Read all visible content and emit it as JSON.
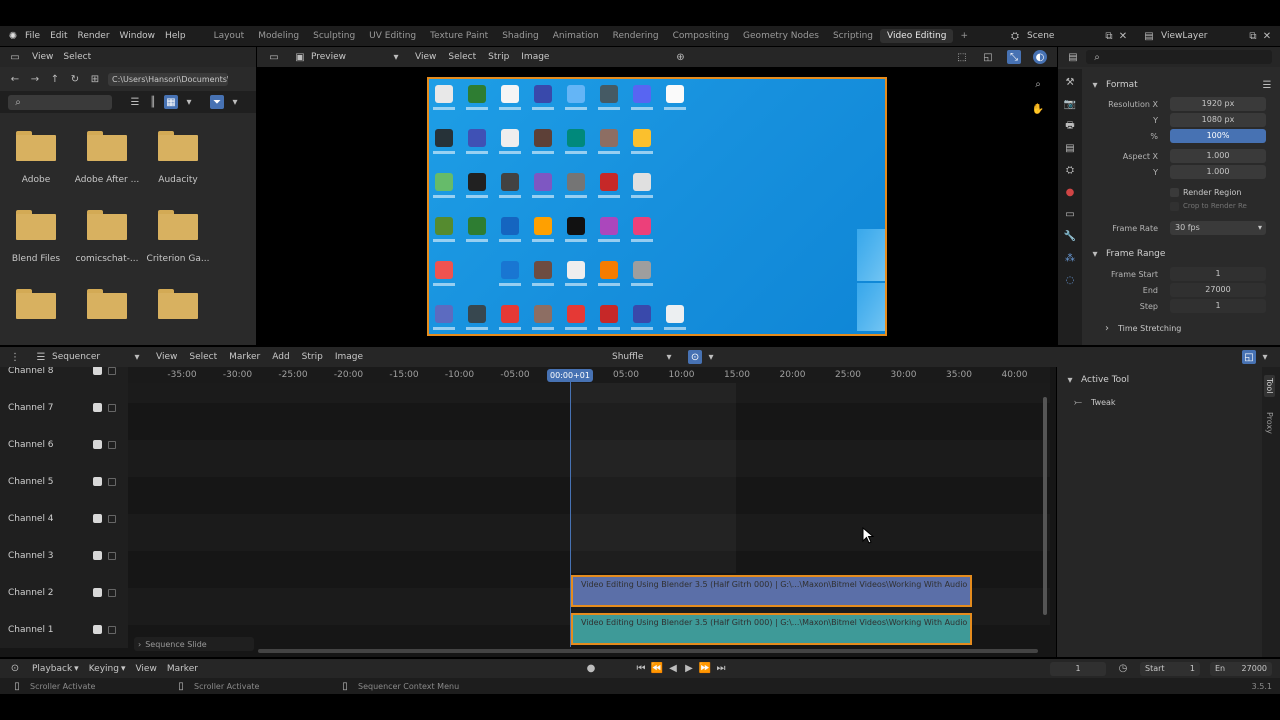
{
  "topbar": {
    "menus": [
      "File",
      "Edit",
      "Render",
      "Window",
      "Help"
    ],
    "workspaces": [
      "Layout",
      "Modeling",
      "Sculpting",
      "UV Editing",
      "Texture Paint",
      "Shading",
      "Animation",
      "Rendering",
      "Compositing",
      "Geometry Nodes",
      "Scripting",
      "Video Editing"
    ],
    "active_workspace": "Video Editing",
    "add_tab": "+",
    "scene": "Scene",
    "view_layer": "ViewLayer"
  },
  "filebrowser": {
    "header": {
      "view": "View",
      "select": "Select"
    },
    "path": "C:\\Users\\Hansori\\Documents\\",
    "folders": [
      "Adobe",
      "Adobe After ...",
      "Audacity",
      "Blend Files",
      "comicschat-...",
      "Criterion Ga...",
      "",
      "",
      ""
    ]
  },
  "preview": {
    "header": {
      "mode": "Preview",
      "view": "View",
      "select": "Select",
      "strip": "Strip",
      "image": "Image"
    }
  },
  "properties": {
    "format_title": "Format",
    "resolution_x_label": "Resolution X",
    "resolution_x": "1920 px",
    "y_label": "Y",
    "resolution_y": "1080 px",
    "percent_label": "%",
    "percent": "100%",
    "aspect_x_label": "Aspect X",
    "aspect_x": "1.000",
    "aspect_y": "1.000",
    "render_region": "Render Region",
    "crop_to_render": "Crop to Render Re",
    "frame_rate_label": "Frame Rate",
    "frame_rate": "30 fps",
    "frame_range_title": "Frame Range",
    "frame_start_label": "Frame Start",
    "frame_start": "1",
    "end_label": "End",
    "frame_end": "27000",
    "step_label": "Step",
    "step": "1",
    "time_stretching": "Time Stretching"
  },
  "sequencer": {
    "header": {
      "editor": "Sequencer",
      "view": "View",
      "select": "Select",
      "marker": "Marker",
      "add": "Add",
      "strip": "Strip",
      "image": "Image",
      "snap": "Shuffle"
    },
    "ticks": [
      "-35:00",
      "-30:00",
      "-25:00",
      "-20:00",
      "-15:00",
      "-10:00",
      "-05:00",
      "00:00+01",
      "05:00",
      "10:00",
      "15:00",
      "20:00",
      "25:00",
      "30:00",
      "35:00",
      "40:00"
    ],
    "current_time": "00:00+01",
    "channels": [
      "Channel 8",
      "Channel 7",
      "Channel 6",
      "Channel 5",
      "Channel 4",
      "Channel 3",
      "Channel 2",
      "Channel 1"
    ],
    "strip_video": "Video Editing Using Blender 3.5 (Half Gitrh 000) | G:\\...\\Maxon\\Bitmel Videos\\Working With Audio",
    "strip_audio": "Video Editing Using Blender 3.5 (Half Gitrh 000) | G:\\...\\Maxon\\Bitmel Videos\\Working With Audio",
    "sequence_slide": "Sequence Slide"
  },
  "tool_panel": {
    "active_tool": "Active Tool",
    "tweak": "Tweak",
    "tab_tool": "Tool",
    "tab_proxy": "Proxy"
  },
  "timeline": {
    "playback": "Playback",
    "keying": "Keying",
    "view": "View",
    "marker": "Marker",
    "current_frame": "1",
    "start_label": "Start",
    "start": "1",
    "end_label": "En",
    "end": "27000"
  },
  "statusbar": {
    "hint1": "Scroller Activate",
    "hint2": "Scroller Activate",
    "hint3": "Sequencer Context Menu",
    "version": "3.5.1"
  },
  "colors": {
    "accent": "#4772b3",
    "strip_video": "#5b6fa8",
    "strip_audio": "#3e9a98",
    "strip_outline": "#e58c1e",
    "desktop": "#1a9ae0"
  }
}
